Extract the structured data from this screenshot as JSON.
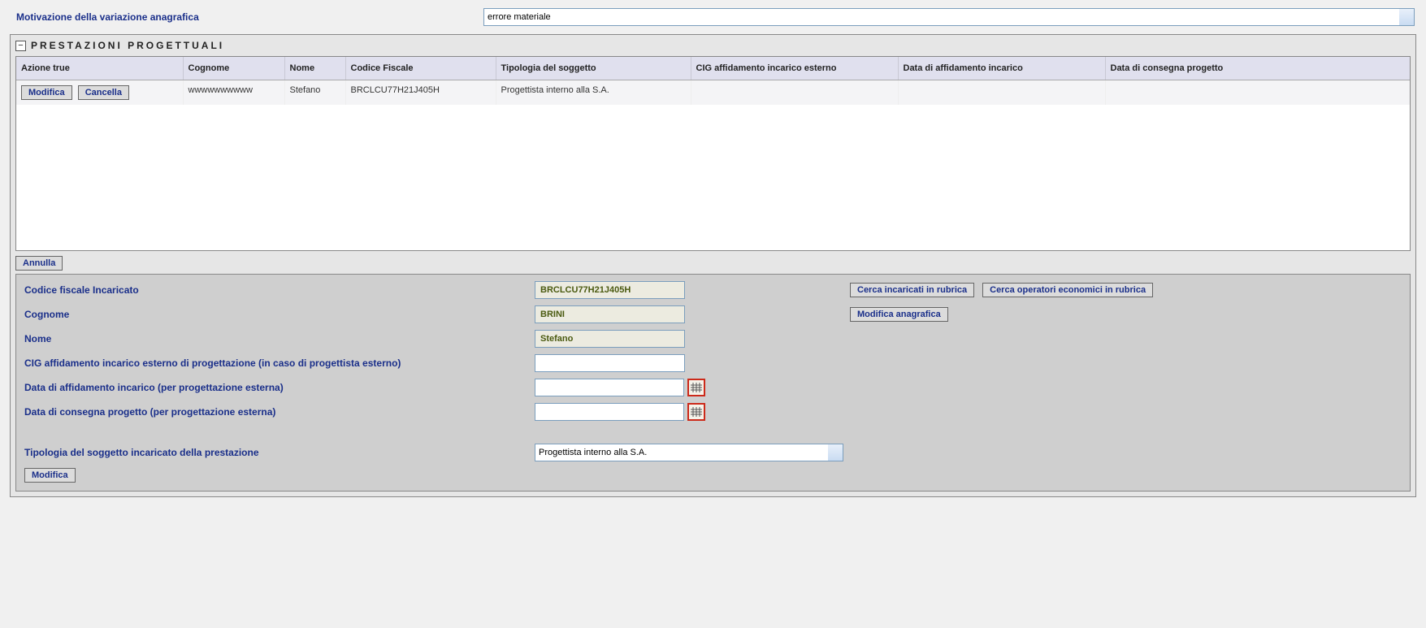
{
  "top": {
    "label": "Motivazione della variazione anagrafica",
    "value": "errore materiale"
  },
  "panel": {
    "title": "PRESTAZIONI PROGETTUALI",
    "collapse_symbol": "−"
  },
  "table": {
    "headers": {
      "azione": "Azione true",
      "cognome": "Cognome",
      "nome": "Nome",
      "cf": "Codice Fiscale",
      "tipologia": "Tipologia del soggetto",
      "cig": "CIG affidamento incarico esterno",
      "data_aff": "Data di affidamento incarico",
      "data_cons": "Data di consegna progetto"
    },
    "rows": [
      {
        "modifica": "Modifica",
        "cancella": "Cancella",
        "cognome": "wwwwwwwwww",
        "nome": "Stefano",
        "cf": "BRCLCU77H21J405H",
        "tipologia": "Progettista interno alla S.A.",
        "cig": "",
        "data_aff": "",
        "data_cons": ""
      }
    ]
  },
  "actions": {
    "annulla": "Annulla",
    "cerca_incaricati": "Cerca incaricati in rubrica",
    "cerca_operatori": "Cerca operatori economici in rubrica",
    "mod_anagrafica": "Modifica anagrafica",
    "modifica_bottom": "Modifica"
  },
  "detail": {
    "labels": {
      "cf": "Codice fiscale Incaricato",
      "cognome": "Cognome",
      "nome": "Nome",
      "cig": "CIG affidamento incarico esterno di progettazione (in caso di progettista esterno)",
      "data_aff": "Data di affidamento incarico (per progettazione esterna)",
      "data_cons": "Data di consegna progetto (per progettazione esterna)",
      "tipologia": "Tipologia del soggetto incaricato della prestazione"
    },
    "values": {
      "cf": "BRCLCU77H21J405H",
      "cognome": "BRINI",
      "nome": "Stefano",
      "cig": "",
      "data_aff": "",
      "data_cons": "",
      "tipologia": "Progettista interno alla S.A."
    }
  }
}
